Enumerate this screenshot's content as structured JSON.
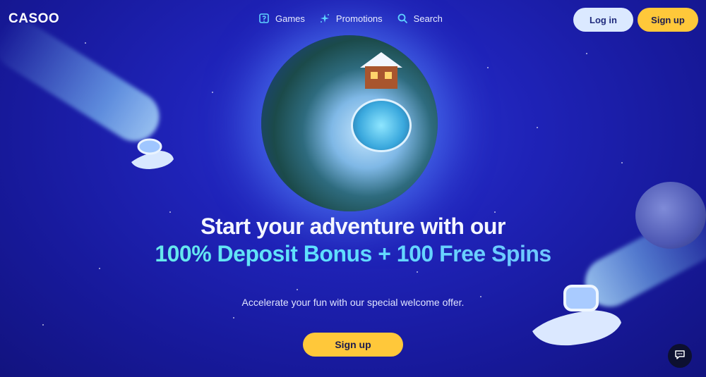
{
  "header": {
    "logo_text": "CASOO",
    "nav": [
      {
        "label": "Games",
        "icon": "games-icon"
      },
      {
        "label": "Promotions",
        "icon": "sparkles-icon"
      },
      {
        "label": "Search",
        "icon": "search-icon"
      }
    ],
    "login_label": "Log in",
    "signup_label": "Sign up"
  },
  "hero": {
    "line1": "Start your adventure with our",
    "line2": "100% Deposit Bonus + 100 Free Spins",
    "subtitle": "Accelerate your fun with our special welcome offer.",
    "cta_label": "Sign up"
  },
  "chat": {
    "icon": "chat-icon"
  },
  "colors": {
    "background": "#1f23b8",
    "accent_yellow": "#ffc83a",
    "login_bg": "#dbe9ff",
    "nav_icon": "#5fd1ff",
    "headline_gradient_start": "#6ff0d8",
    "headline_gradient_end": "#7ab6ff"
  }
}
